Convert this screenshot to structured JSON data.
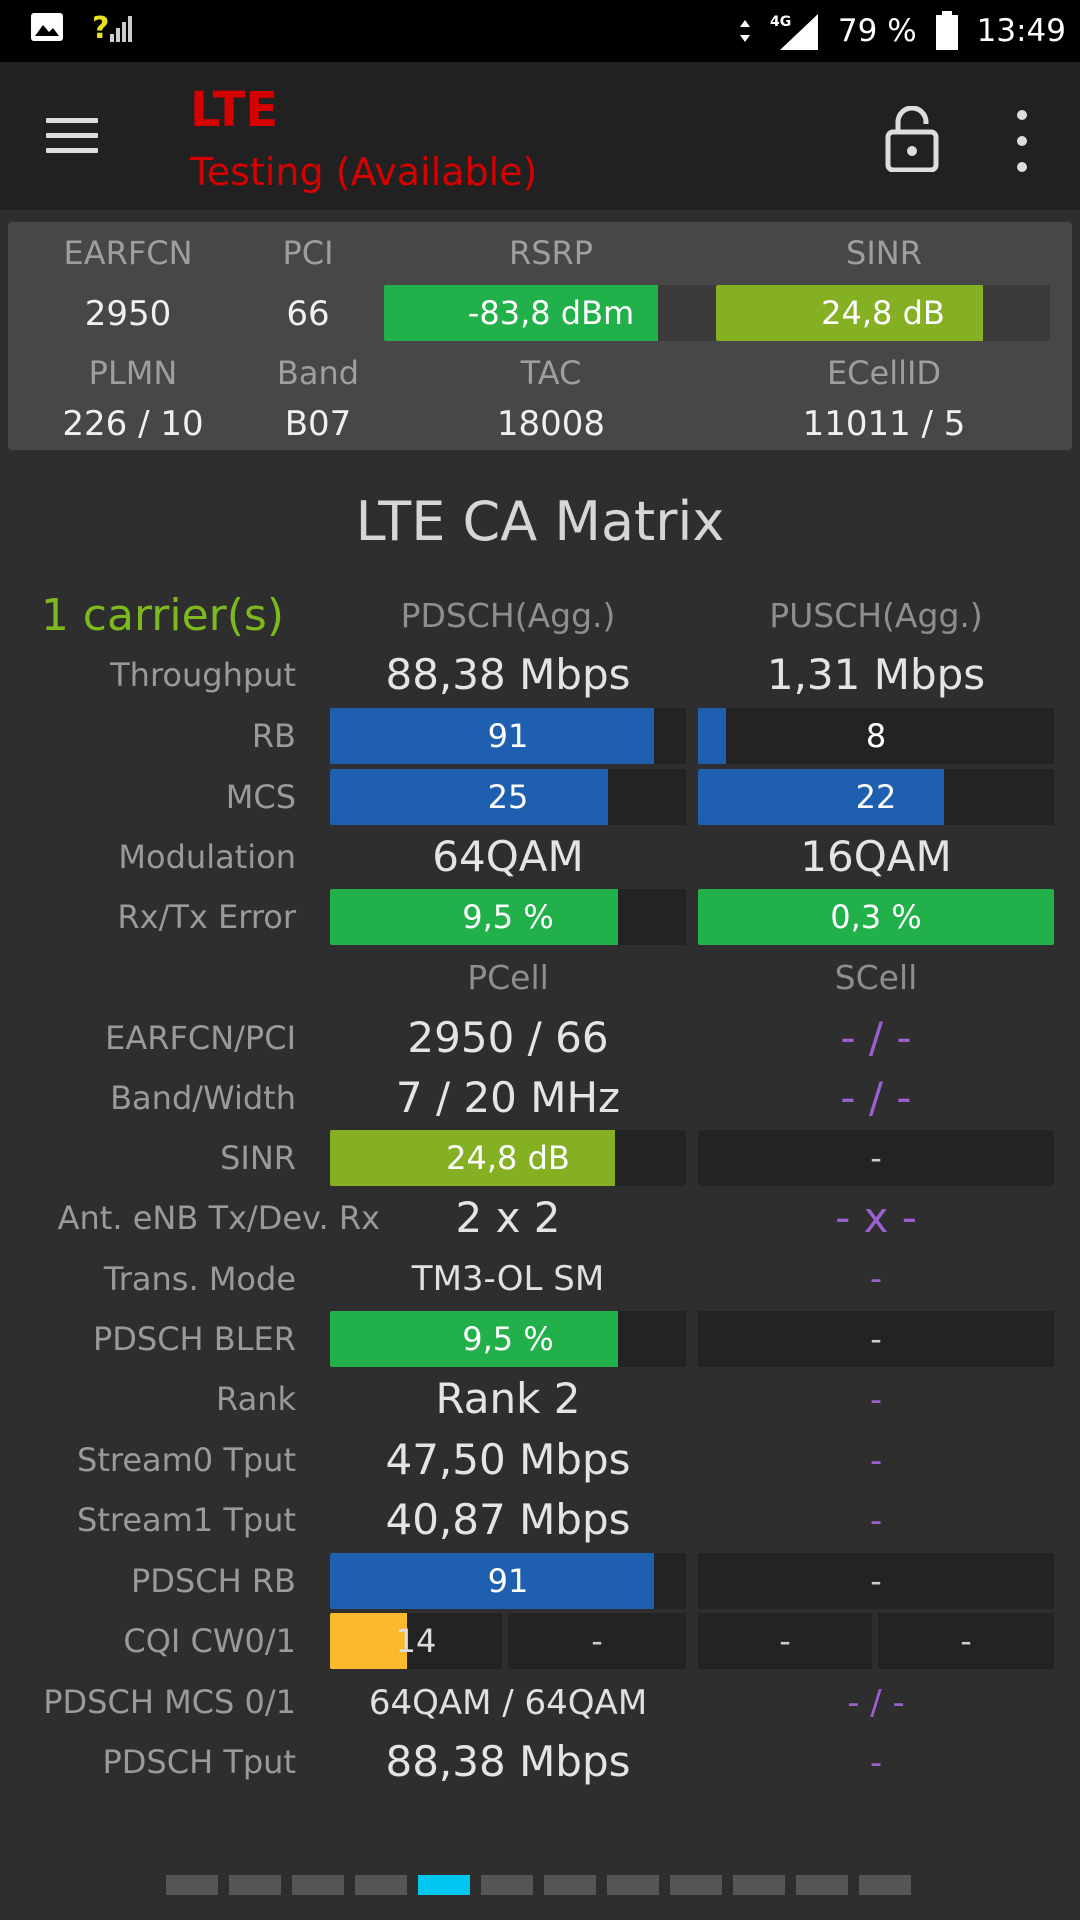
{
  "status_bar": {
    "battery": "79 %",
    "time": "13:49",
    "network": "4G",
    "signal": "?"
  },
  "toolbar": {
    "title": "LTE",
    "subtitle": "Testing (Available)"
  },
  "summary": {
    "earfcn_label": "EARFCN",
    "earfcn": "2950",
    "pci_label": "PCI",
    "pci": "66",
    "rsrp_label": "RSRP",
    "rsrp": "-83,8 dBm",
    "rsrp_level": 0.82,
    "sinr_label": "SINR",
    "sinr": "24,8 dB",
    "sinr_level": 0.8,
    "plmn_label": "PLMN",
    "plmn": "226 / 10",
    "band_label": "Band",
    "band": "B07",
    "tac_label": "TAC",
    "tac": "18008",
    "ecellid_label": "ECellID",
    "ecellid": "11011 / 5"
  },
  "matrix": {
    "title": "LTE CA Matrix",
    "carriers": "1 carrier(s)",
    "pdsch_header": "PDSCH(Agg.)",
    "pusch_header": "PUSCH(Agg.)",
    "throughput": {
      "label": "Throughput",
      "pdsch": "88,38 Mbps",
      "pusch": "1,31 Mbps"
    },
    "rb": {
      "label": "RB",
      "pdsch": "91",
      "pdsch_level": 0.91,
      "pusch": "8",
      "pusch_level": 0.08
    },
    "mcs": {
      "label": "MCS",
      "pdsch": "25",
      "pdsch_level": 0.78,
      "pusch": "22",
      "pusch_level": 0.69
    },
    "modulation": {
      "label": "Modulation",
      "pdsch": "64QAM",
      "pusch": "16QAM"
    },
    "error": {
      "label": "Rx/Tx Error",
      "pdsch": "9,5 %",
      "pdsch_level": 0.81,
      "pusch": "0,3 %",
      "pusch_level": 1.0
    },
    "pcell_header": "PCell",
    "scell_header": "SCell",
    "earfcn_pci": {
      "label": "EARFCN/PCI",
      "pcell": "2950 / 66",
      "scell": "- / -"
    },
    "band_width": {
      "label": "Band/Width",
      "pcell": "7 / 20 MHz",
      "scell": "- / -"
    },
    "sinr": {
      "label": "SINR",
      "pcell": "24,8 dB",
      "pcell_level": 0.8,
      "scell": "-"
    },
    "ant": {
      "label": "Ant. eNB Tx/Dev. Rx",
      "pcell": "2 x 2",
      "scell": "- x -"
    },
    "trans_mode": {
      "label": "Trans. Mode",
      "pcell": "TM3-OL SM",
      "scell": "-"
    },
    "bler": {
      "label": "PDSCH BLER",
      "pcell": "9,5 %",
      "pcell_level": 0.81,
      "scell": "-"
    },
    "rank": {
      "label": "Rank",
      "pcell": "Rank 2",
      "scell": "-"
    },
    "stream0": {
      "label": "Stream0 Tput",
      "pcell": "47,50 Mbps",
      "scell": "-"
    },
    "stream1": {
      "label": "Stream1 Tput",
      "pcell": "40,87 Mbps",
      "scell": "-"
    },
    "pdsch_rb": {
      "label": "PDSCH RB",
      "pcell": "91",
      "pcell_level": 0.91,
      "scell": "-"
    },
    "cqi": {
      "label": "CQI CW0/1",
      "cw0": "14",
      "cw0_level": 0.45,
      "cw1": "-",
      "scell_cw0": "-",
      "scell_cw1": "-"
    },
    "pdsch_mcs": {
      "label": "PDSCH MCS 0/1",
      "pcell": "64QAM / 64QAM",
      "scell": "- / -"
    },
    "pdsch_tput": {
      "label": "PDSCH Tput",
      "pcell": "88,38 Mbps",
      "scell": "-"
    }
  },
  "pager": {
    "pages": 12,
    "active": 5
  },
  "colors": {
    "blue": "#1e5fb0",
    "green": "#22b04a",
    "lime": "#86b024",
    "amber": "#fbb92e",
    "red": "#d50000",
    "accent": "#00c6f0"
  }
}
